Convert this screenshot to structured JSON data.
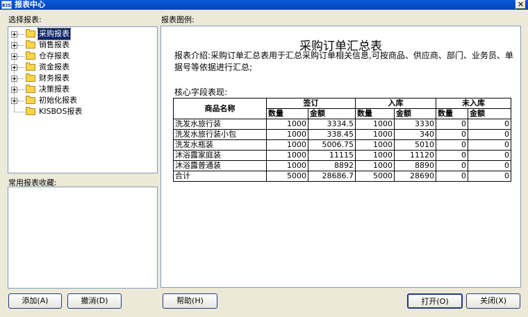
{
  "window": {
    "app_icon": "KIS",
    "title": "报表中心",
    "close_glyph": "✕"
  },
  "labels": {
    "select_report": "选择报表:",
    "preview": "报表图例:",
    "favorites": "常用报表收藏:"
  },
  "tree": {
    "items": [
      {
        "label": "采购报表",
        "expandable": true,
        "selected": true
      },
      {
        "label": "销售报表",
        "expandable": true,
        "selected": false
      },
      {
        "label": "仓存报表",
        "expandable": true,
        "selected": false
      },
      {
        "label": "资金报表",
        "expandable": true,
        "selected": false
      },
      {
        "label": "财务报表",
        "expandable": true,
        "selected": false
      },
      {
        "label": "决策报表",
        "expandable": true,
        "selected": false
      },
      {
        "label": "初始化报表",
        "expandable": true,
        "selected": false
      },
      {
        "label": "KISBOS报表",
        "expandable": false,
        "selected": false
      }
    ]
  },
  "report": {
    "title": "采购订单汇总表",
    "intro": "报表介绍:采购订单汇总表用于汇总采购订单相关信息,可按商品、供应商、部门、业务员、单据号等依据进行汇总;",
    "core_fields": "核心字段表现:",
    "table": {
      "name_header": "商品名称",
      "groups": [
        "签订",
        "入库",
        "未入库"
      ],
      "subheaders": [
        "数量",
        "金额",
        "数量",
        "金额",
        "数量",
        "金额"
      ],
      "rows": [
        [
          "洗发水旅行装",
          "1000",
          "3334.5",
          "1000",
          "3330",
          "0",
          "0"
        ],
        [
          "洗发水旅行装小包",
          "1000",
          "338.45",
          "1000",
          "340",
          "0",
          "0"
        ],
        [
          "洗发水瓶装",
          "1000",
          "5006.75",
          "1000",
          "5010",
          "0",
          "0"
        ],
        [
          "沐浴露家庭装",
          "1000",
          "11115",
          "1000",
          "11120",
          "0",
          "0"
        ],
        [
          "沐浴露普通装",
          "1000",
          "8892",
          "1000",
          "8890",
          "0",
          "0"
        ],
        [
          "合计",
          "5000",
          "28686.7",
          "5000",
          "28690",
          "0",
          "0"
        ]
      ]
    }
  },
  "buttons": {
    "add": "添加(A)",
    "cancel": "撤消(D)",
    "help": "帮助(H)",
    "open": "打开(O)",
    "close": "关闭(X)"
  },
  "colors": {
    "title_bar": "#0a5bd8",
    "window_bg": "#ece9d8",
    "selection": "#0a246a"
  }
}
